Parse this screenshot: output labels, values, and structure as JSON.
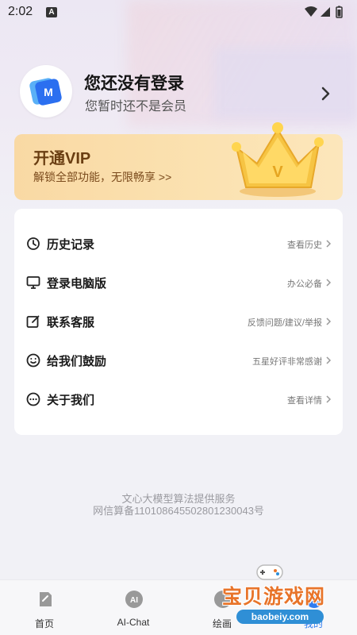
{
  "status_bar": {
    "time": "2:02",
    "notification_badge": "A",
    "icons": [
      "wifi-icon",
      "signal-icon",
      "battery-icon"
    ]
  },
  "profile": {
    "title": "您还没有登录",
    "subtitle": "您暂时还不是会员",
    "avatar_icon": "app-logo-icon"
  },
  "vip": {
    "title": "开通VIP",
    "subtitle": "解锁全部功能，无限畅享 >>",
    "badge_letter": "V"
  },
  "menu": {
    "items": [
      {
        "label": "历史记录",
        "hint": "查看历史",
        "icon": "history-icon"
      },
      {
        "label": "登录电脑版",
        "hint": "办公必备",
        "icon": "monitor-icon"
      },
      {
        "label": "联系客服",
        "hint": "反馈问题/建议/举报",
        "icon": "edit-icon"
      },
      {
        "label": "给我们鼓励",
        "hint": "五星好评非常感谢",
        "icon": "smile-icon"
      },
      {
        "label": "关于我们",
        "hint": "查看详情",
        "icon": "more-icon"
      }
    ]
  },
  "footer": {
    "line1": "文心大模型算法提供服务",
    "line2": "网信算备110108645502801230043号"
  },
  "nav": {
    "items": [
      {
        "label": "首页",
        "icon": "home-icon"
      },
      {
        "label": "AI-Chat",
        "icon": "ai-chat-icon",
        "badge": "AI"
      },
      {
        "label": "绘画",
        "icon": "paint-icon"
      },
      {
        "label": "我的",
        "icon": "profile-icon"
      }
    ]
  },
  "watermark": {
    "title": "宝贝游戏网",
    "url": "baobeiy.com"
  },
  "colors": {
    "vip_gold": "#fbe2b1",
    "vip_text": "#6a3e12",
    "brand_blue": "#2f7cf0",
    "watermark_orange": "#e8742a"
  }
}
